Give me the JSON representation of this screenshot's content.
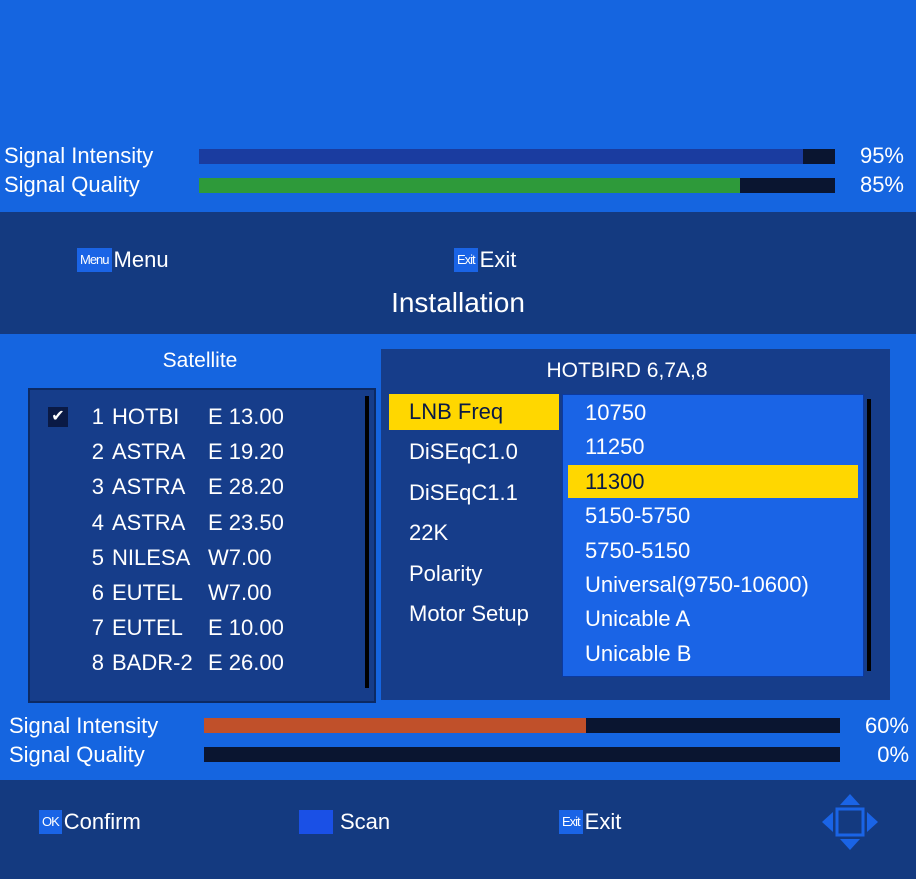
{
  "top_signal": {
    "intensity_label": "Signal Intensity",
    "intensity_value": "95%",
    "intensity_fraction": 0.95,
    "intensity_color": "#1a3ca0",
    "quality_label": "Signal Quality",
    "quality_value": "85%",
    "quality_fraction": 0.85,
    "quality_color": "#2e9a3a"
  },
  "header": {
    "menu_key": "Menu",
    "menu_label": "Menu",
    "exit_key": "Exit",
    "exit_label": "Exit",
    "title": "Installation"
  },
  "satellite": {
    "header": "Satellite",
    "items": [
      {
        "checked": true,
        "num": "1",
        "name": "HOTBI",
        "pos": "E 13.00"
      },
      {
        "checked": false,
        "num": "2",
        "name": "ASTRA",
        "pos": "E 19.20"
      },
      {
        "checked": false,
        "num": "3",
        "name": "ASTRA",
        "pos": "E 28.20"
      },
      {
        "checked": false,
        "num": "4",
        "name": "ASTRA",
        "pos": "E 23.50"
      },
      {
        "checked": false,
        "num": "5",
        "name": "NILESA",
        "pos": "W7.00"
      },
      {
        "checked": false,
        "num": "6",
        "name": "EUTEL",
        "pos": "W7.00"
      },
      {
        "checked": false,
        "num": "7",
        "name": "EUTEL",
        "pos": "E 10.00"
      },
      {
        "checked": false,
        "num": "8",
        "name": "BADR-2",
        "pos": "E 26.00"
      }
    ]
  },
  "settings": {
    "title": "HOTBIRD 6,7A,8",
    "items": [
      "LNB Freq",
      "DiSEqC1.0",
      "DiSEqC1.1",
      "22K",
      "Polarity",
      "Motor Setup"
    ],
    "selected_index": 0,
    "dropdown": {
      "options": [
        "10750",
        "11250",
        "11300",
        "5150-5750",
        "5750-5150",
        "Universal(9750-10600)",
        "Unicable A",
        "Unicable B"
      ],
      "selected_index": 2
    }
  },
  "bottom_signal": {
    "intensity_label": "Signal Intensity",
    "intensity_value": "60%",
    "intensity_fraction": 0.6,
    "intensity_color": "#c0502a",
    "quality_label": "Signal Quality",
    "quality_value": "0%",
    "quality_fraction": 0.0,
    "quality_color": "#c0502a"
  },
  "footer": {
    "ok_key": "OK",
    "confirm_label": "Confirm",
    "scan_label": "Scan",
    "exit_key": "Exit",
    "exit_label": "Exit",
    "nav_icon": "dpad-arrows-icon"
  },
  "colors": {
    "background": "#1565e0",
    "band": "#143a80",
    "highlight": "#ffd700"
  }
}
